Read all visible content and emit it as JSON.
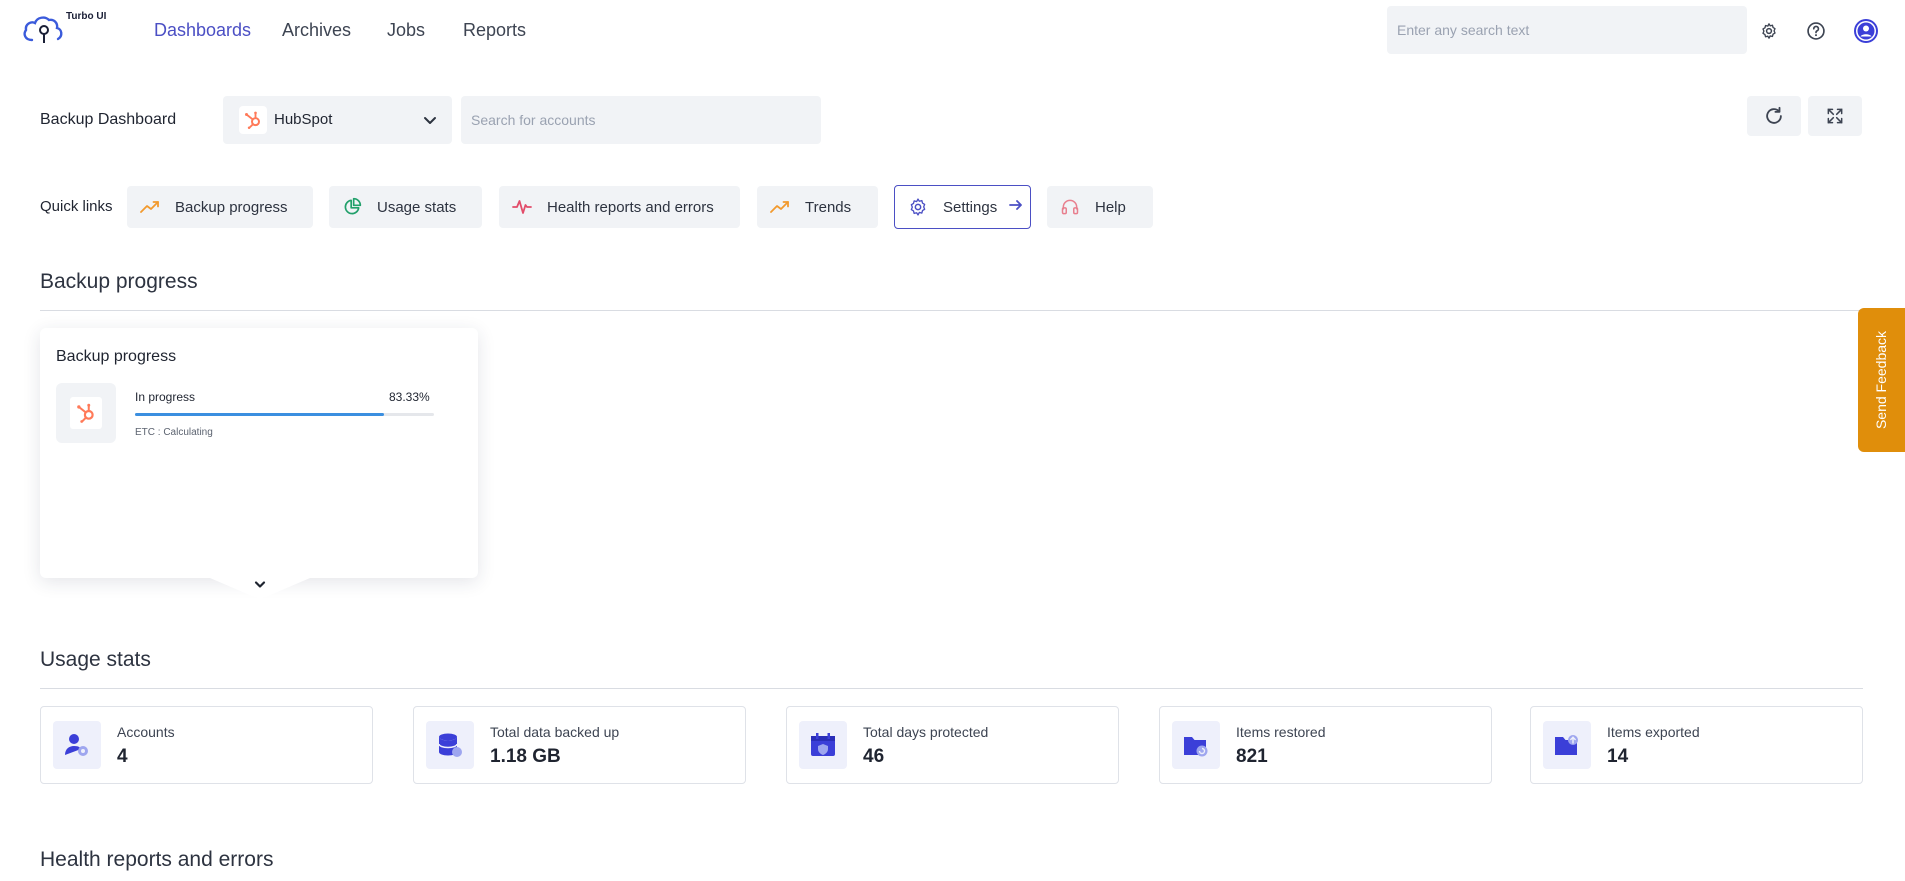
{
  "app": {
    "logo_text": "Turbo UI"
  },
  "nav": {
    "items": [
      {
        "label": "Dashboards",
        "active": true
      },
      {
        "label": "Archives",
        "active": false
      },
      {
        "label": "Jobs",
        "active": false
      },
      {
        "label": "Reports",
        "active": false
      }
    ],
    "search_placeholder": "Enter any search text"
  },
  "header": {
    "title": "Backup Dashboard",
    "account_selected": "HubSpot",
    "account_search_placeholder": "Search for accounts"
  },
  "quick_links": {
    "label": "Quick links",
    "items": [
      {
        "label": "Backup progress",
        "icon": "trend-up-icon"
      },
      {
        "label": "Usage stats",
        "icon": "pie-chart-icon"
      },
      {
        "label": "Health reports and errors",
        "icon": "pulse-icon"
      },
      {
        "label": "Trends",
        "icon": "trend-up-icon"
      },
      {
        "label": "Settings",
        "icon": "gear-icon"
      },
      {
        "label": "Help",
        "icon": "headset-icon"
      }
    ]
  },
  "backup_progress": {
    "section_title": "Backup progress",
    "card_title": "Backup progress",
    "status": "In progress",
    "percent_label": "83.33%",
    "percent": 83.33,
    "etc": "ETC : Calculating"
  },
  "usage_stats": {
    "section_title": "Usage stats",
    "items": [
      {
        "label": "Accounts",
        "value": "4",
        "icon": "user-gear-icon"
      },
      {
        "label": "Total data backed up",
        "value": "1.18 GB",
        "icon": "database-icon"
      },
      {
        "label": "Total days protected",
        "value": "46",
        "icon": "calendar-shield-icon"
      },
      {
        "label": "Items restored",
        "value": "821",
        "icon": "folder-restore-icon"
      },
      {
        "label": "Items exported",
        "value": "14",
        "icon": "folder-export-icon"
      }
    ]
  },
  "health": {
    "section_title": "Health reports and errors"
  },
  "feedback": {
    "label": "Send Feedback"
  },
  "colors": {
    "accent": "#4b4fc4",
    "hubspot": "#ff7a59",
    "progress": "#3b8fe0",
    "feedback": "#e08e0b"
  }
}
